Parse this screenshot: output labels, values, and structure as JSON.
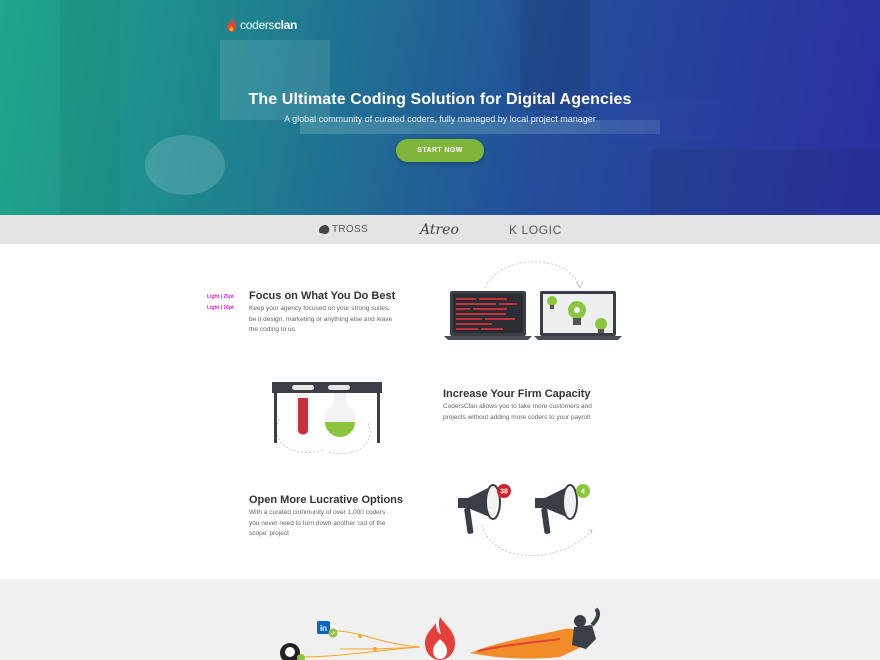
{
  "brand": {
    "name_light": "coders",
    "name_bold": "clan"
  },
  "hero": {
    "title": "The Ultimate Coding Solution for Digital Agencies",
    "subtitle": "A global community of curated coders, fully managed by local project manager",
    "cta_label": "START NOW"
  },
  "clients": [
    {
      "name": "TROSS"
    },
    {
      "name": "Atreo"
    },
    {
      "name": "K LOGIC"
    }
  ],
  "annotations": [
    "Light | 25pt",
    "Light | 16pt"
  ],
  "features": [
    {
      "title": "Focus on What You Do Best",
      "description": [
        "Keep your agency focused on your strong suites,",
        "be it design, marketing or anything else and leave",
        "the coding to us."
      ]
    },
    {
      "title": "Increase Your Firm Capacity",
      "description": [
        "CodersClan allows you to take more customers and",
        "projects without adding more coders to your payroll"
      ]
    },
    {
      "title": "Open More Lucrative Options",
      "description": [
        "With a curated community of over 1,000 coders",
        "you never need to turn down another 'out of the",
        "scope' project"
      ]
    }
  ],
  "megaphone_badges": [
    "38",
    "4"
  ],
  "colors": {
    "accent_green": "#7fb53a",
    "badge_red": "#d0202e",
    "annotation_magenta": "#e21bd6",
    "hero_start": "#1fa88a",
    "hero_end": "#2a2f9e"
  },
  "icons": [
    "flame-logo-icon",
    "laptop-code-icon",
    "laptop-bulbs-icon",
    "test-tubes-icon",
    "megaphone-icon",
    "linkedin-icon",
    "github-icon",
    "superhero-icon"
  ]
}
